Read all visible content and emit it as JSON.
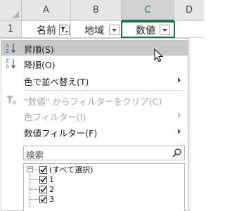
{
  "spreadsheet": {
    "columns": [
      "A",
      "B",
      "C",
      "D"
    ],
    "selected_column": "C",
    "row_number": "1",
    "header_cells": [
      {
        "text": "名前"
      },
      {
        "text": "地域"
      },
      {
        "text": "数値"
      }
    ],
    "accent_color": "#217346"
  },
  "menu": {
    "sort_asc": "昇順(S)",
    "sort_desc": "降順(O)",
    "sort_by_color": "色で並べ替え(T)",
    "clear_filter": "\"数値\" からフィルターをクリア(C)",
    "color_filter": "色フィルター(I)",
    "number_filter": "数値フィルター(F)",
    "search_placeholder": "検索",
    "values": [
      {
        "label": "(すべて選択)",
        "checked": true
      },
      {
        "label": "1",
        "checked": true
      },
      {
        "label": "2",
        "checked": true
      },
      {
        "label": "3",
        "checked": true
      }
    ],
    "hover_color": "#c8c8c8"
  },
  "icons": {
    "sort_asc": "sort-ascending-icon",
    "sort_desc": "sort-descending-icon",
    "clear_filter": "clear-filter-icon",
    "search": "search-icon",
    "filter": "filter-funnel-icon",
    "dropdown": "dropdown-arrow-icon",
    "cursor": "mouse-pointer-icon"
  }
}
